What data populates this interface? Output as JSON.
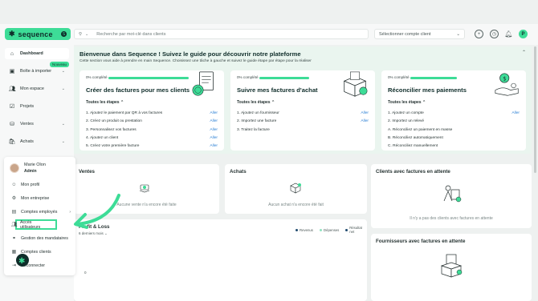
{
  "header": {
    "logo_text": "sequence",
    "logo_mark": "✱",
    "logo_badge": "S",
    "search_placeholder": "Recherche par mot-clé dans clients",
    "client_select": "Sélectionner compte client",
    "user_initial": "P"
  },
  "sidebar": {
    "items": [
      {
        "label": "Dashboard",
        "icon": "home-icon"
      },
      {
        "label": "Boîte à importer",
        "icon": "inbox-icon"
      },
      {
        "label": "Mon espace",
        "icon": "users-icon"
      },
      {
        "label": "Projets",
        "icon": "check-square-icon"
      },
      {
        "label": "Ventes",
        "icon": "coins-icon"
      },
      {
        "label": "Achats",
        "icon": "bag-icon"
      }
    ],
    "new_badge": "Nouveau"
  },
  "user_menu": {
    "name": "Marie Olon",
    "role": "Admin",
    "items": [
      {
        "label": "Mon profil",
        "icon": "user-icon"
      },
      {
        "label": "Mon entreprise",
        "icon": "gear-icon"
      },
      {
        "label": "Comptes employés",
        "icon": "briefcase-icon"
      },
      {
        "label": "Accès utilisateurs",
        "icon": "users-icon"
      },
      {
        "label": "Gestion des mandataires",
        "icon": "network-icon"
      },
      {
        "label": "Comptes clients",
        "icon": "contacts-icon"
      },
      {
        "label": "Déconnecter",
        "icon": "logout-icon"
      }
    ]
  },
  "welcome": {
    "title": "Bienvenue dans Sequence ! Suivez le guide pour découvrir notre plateforme",
    "subtitle": "Cette section vous aide à prendre en main Sequence. Choisissez une tâche à gauche et suivez le guide étape par étape pour la réaliser",
    "progress_label": "0% complété",
    "all_steps_label": "Toutes les étapes",
    "go_label": "Aller",
    "cards": [
      {
        "title": "Créer des factures pour mes clients",
        "progress": 0,
        "steps": [
          {
            "text": "1. Ajoutez le paiement par QR à vos factures",
            "go": true
          },
          {
            "text": "2. Créez un produit ou prestation",
            "go": true
          },
          {
            "text": "3. Personnalisez vos factures",
            "go": true
          },
          {
            "text": "4. Ajoutez un client",
            "go": true
          },
          {
            "text": "5. Créez votre première facture",
            "go": true
          }
        ]
      },
      {
        "title": "Suivre mes factures d'achat",
        "progress": 0,
        "steps": [
          {
            "text": "1. Ajoutez un fournisseur",
            "go": true
          },
          {
            "text": "2. Importez une facture",
            "go": true
          },
          {
            "text": "3. Traitez la facture",
            "go": false
          }
        ]
      },
      {
        "title": "Réconcilier mes paiements",
        "progress": 0,
        "steps": [
          {
            "text": "1. Ajoutez un compte",
            "go": true
          },
          {
            "text": "2. Importez un relevé",
            "go": false
          },
          {
            "text": "A. Réconciliez un paiement en masse",
            "go": false
          },
          {
            "text": "B. Réconciliez automatiquement",
            "go": false
          },
          {
            "text": "C. Réconciliez manuellement",
            "go": false
          }
        ]
      }
    ]
  },
  "panels": {
    "ventes": {
      "title": "Ventes",
      "empty": "Aucune vente n'a encore été faite"
    },
    "achats": {
      "title": "Achats",
      "empty": "Aucun achat n'a encore été fait"
    },
    "clients": {
      "title": "Clients avec factures en attente",
      "empty": "Il n'y a pas des clients avec factures en attente"
    },
    "fournisseurs": {
      "title": "Fournisseurs avec factures en attente"
    },
    "profit": {
      "title": "Profit & Loss",
      "period": "6 derniers mois",
      "axis_zero": "0",
      "legend": [
        {
          "label": "Revenus",
          "color": "#1f4a6e"
        },
        {
          "label": "Dépenses",
          "color": "#8fe3c0"
        },
        {
          "label": "Résultat net",
          "color": "#1f4a6e"
        }
      ]
    }
  },
  "colors": {
    "accent": "#3ddc97",
    "link": "#2a7fd4",
    "dark": "#0f2d2a"
  }
}
